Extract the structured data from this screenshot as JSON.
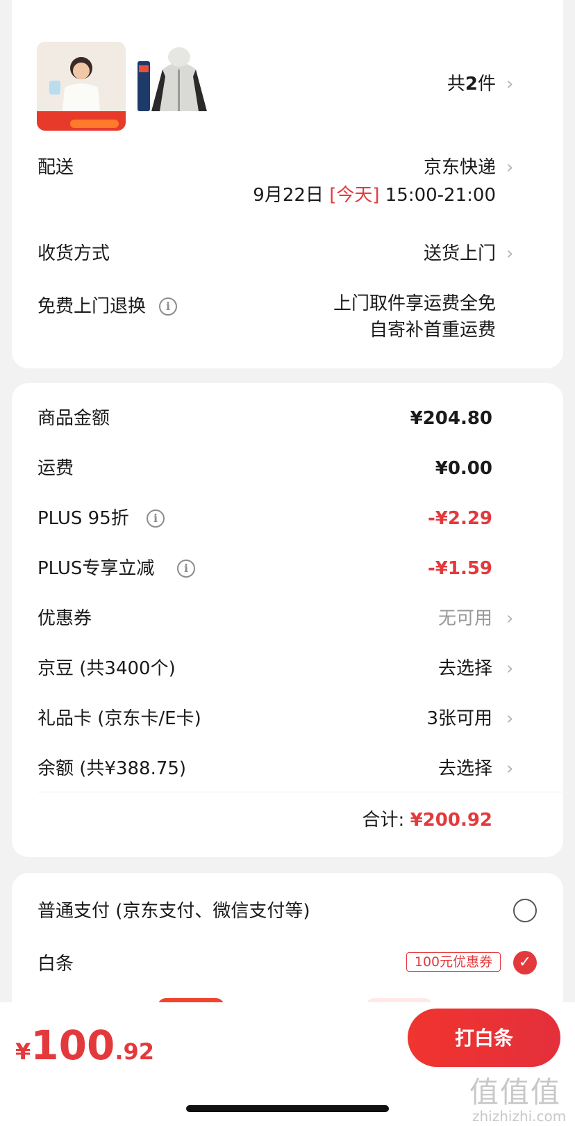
{
  "items": {
    "count_prefix": "共",
    "count_num": "2",
    "count_suffix": "件"
  },
  "delivery": {
    "label": "配送",
    "method": "京东快递",
    "date": "9月22日",
    "today": "[今天]",
    "time": "15:00-21:00"
  },
  "receive": {
    "label": "收货方式",
    "value": "送货上门"
  },
  "return": {
    "label": "免费上门退换",
    "line1": "上门取件享运费全免",
    "line2": "自寄补首重运费"
  },
  "costs": {
    "goods_label": "商品金额",
    "goods_value": "¥204.80",
    "shipping_label": "运费",
    "shipping_value": "¥0.00",
    "plus95_label": "PLUS 95折",
    "plus95_value": "-¥2.29",
    "plus_cut_label": "PLUS专享立减",
    "plus_cut_value": "-¥1.59",
    "coupon_label": "优惠券",
    "coupon_value": "无可用",
    "jingdou_label": "京豆 (共3400个)",
    "jingdou_value": "去选择",
    "giftcard_label": "礼品卡 (京东卡/E卡)",
    "giftcard_value": "3张可用",
    "balance_label": "余额 (共¥388.75)",
    "balance_value": "去选择",
    "total_label": "合计:",
    "total_value": "¥200.92"
  },
  "payment": {
    "normal_label": "普通支付 (京东支付、微信支付等)",
    "baitiao_label": "白条",
    "baitiao_coupon": "100元优惠券"
  },
  "bottom": {
    "currency": "¥",
    "price_int": "100",
    "price_dec": ".92",
    "pay_button": "打白条"
  },
  "watermark": {
    "site": "zhizhizhi.com",
    "logo": "值值值"
  },
  "colors": {
    "accent": "#e4393c",
    "background": "#f2f2f2"
  }
}
